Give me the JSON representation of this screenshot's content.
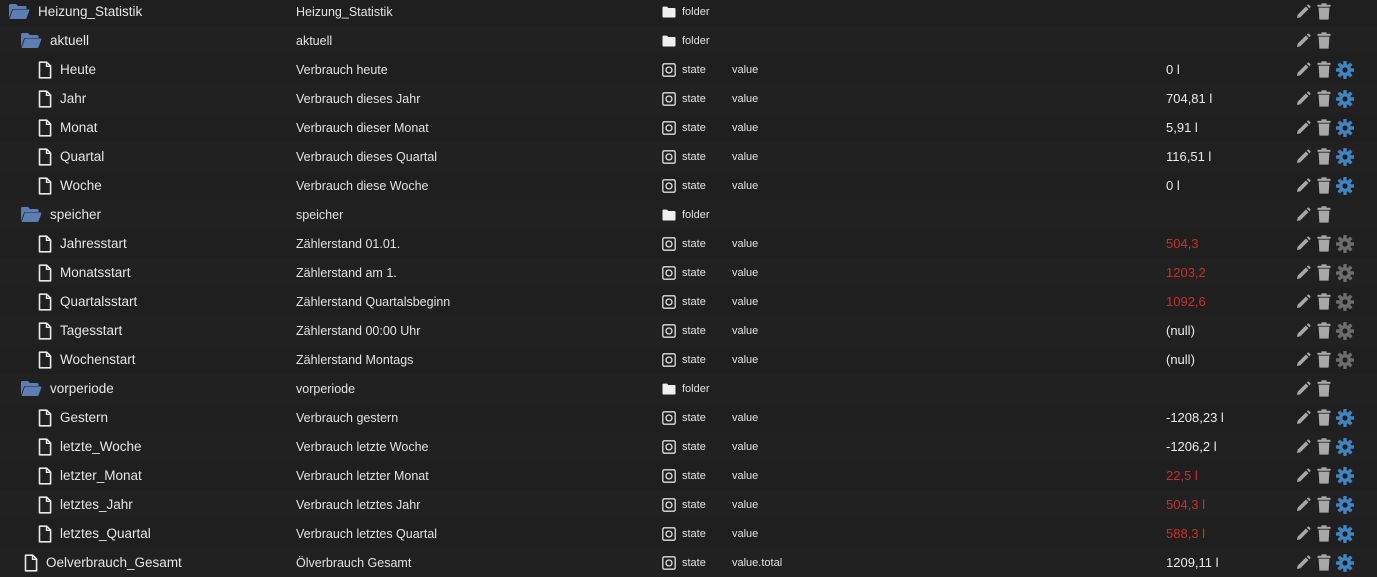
{
  "colors": {
    "background": "#1f1f1f",
    "text": "#e6e6e6",
    "folder_icon": "#5d7eb5",
    "action_icon": "#a8a8a8",
    "gear_active": "#3f85c2",
    "gear_inactive": "#6d6d6d",
    "value_red": "#c8302a"
  },
  "rows": [
    {
      "name": "Heizung_Statistik",
      "desc": "Heizung_Statistik",
      "type": "folder",
      "role": "",
      "value": "",
      "red": false,
      "kind": "folder",
      "depth": 0,
      "gear": "none"
    },
    {
      "name": "aktuell",
      "desc": "aktuell",
      "type": "folder",
      "role": "",
      "value": "",
      "red": false,
      "kind": "folder",
      "depth": 1,
      "gear": "none"
    },
    {
      "name": "Heute",
      "desc": "Verbrauch heute",
      "type": "state",
      "role": "value",
      "value": "0 l",
      "red": false,
      "kind": "file",
      "depth": 2,
      "gear": "active"
    },
    {
      "name": "Jahr",
      "desc": "Verbrauch dieses Jahr",
      "type": "state",
      "role": "value",
      "value": "704,81 l",
      "red": false,
      "kind": "file",
      "depth": 2,
      "gear": "active"
    },
    {
      "name": "Monat",
      "desc": "Verbrauch dieser Monat",
      "type": "state",
      "role": "value",
      "value": "5,91 l",
      "red": false,
      "kind": "file",
      "depth": 2,
      "gear": "active"
    },
    {
      "name": "Quartal",
      "desc": "Verbrauch dieses Quartal",
      "type": "state",
      "role": "value",
      "value": "116,51 l",
      "red": false,
      "kind": "file",
      "depth": 2,
      "gear": "active"
    },
    {
      "name": "Woche",
      "desc": "Verbrauch diese Woche",
      "type": "state",
      "role": "value",
      "value": "0 l",
      "red": false,
      "kind": "file",
      "depth": 2,
      "gear": "active"
    },
    {
      "name": "speicher",
      "desc": "speicher",
      "type": "folder",
      "role": "",
      "value": "",
      "red": false,
      "kind": "folder",
      "depth": 1,
      "gear": "none"
    },
    {
      "name": "Jahresstart",
      "desc": "Zählerstand 01.01.",
      "type": "state",
      "role": "value",
      "value": "504,3",
      "red": true,
      "kind": "file",
      "depth": 2,
      "gear": "inactive"
    },
    {
      "name": "Monatsstart",
      "desc": "Zählerstand am 1.",
      "type": "state",
      "role": "value",
      "value": "1203,2",
      "red": true,
      "kind": "file",
      "depth": 2,
      "gear": "inactive"
    },
    {
      "name": "Quartalsstart",
      "desc": "Zählerstand Quartalsbeginn",
      "type": "state",
      "role": "value",
      "value": "1092,6",
      "red": true,
      "kind": "file",
      "depth": 2,
      "gear": "inactive"
    },
    {
      "name": "Tagesstart",
      "desc": "Zählerstand 00:00 Uhr",
      "type": "state",
      "role": "value",
      "value": "(null)",
      "red": false,
      "kind": "file",
      "depth": 2,
      "gear": "inactive"
    },
    {
      "name": "Wochenstart",
      "desc": "Zählerstand Montags",
      "type": "state",
      "role": "value",
      "value": "(null)",
      "red": false,
      "kind": "file",
      "depth": 2,
      "gear": "inactive"
    },
    {
      "name": "vorperiode",
      "desc": "vorperiode",
      "type": "folder",
      "role": "",
      "value": "",
      "red": false,
      "kind": "folder",
      "depth": 1,
      "gear": "none"
    },
    {
      "name": "Gestern",
      "desc": "Verbrauch gestern",
      "type": "state",
      "role": "value",
      "value": "-1208,23 l",
      "red": false,
      "kind": "file",
      "depth": 2,
      "gear": "active"
    },
    {
      "name": "letzte_Woche",
      "desc": "Verbrauch letzte Woche",
      "type": "state",
      "role": "value",
      "value": "-1206,2 l",
      "red": false,
      "kind": "file",
      "depth": 2,
      "gear": "active"
    },
    {
      "name": "letzter_Monat",
      "desc": "Verbrauch letzter Monat",
      "type": "state",
      "role": "value",
      "value": "22,5 l",
      "red": true,
      "kind": "file",
      "depth": 2,
      "gear": "active"
    },
    {
      "name": "letztes_Jahr",
      "desc": "Verbrauch letztes Jahr",
      "type": "state",
      "role": "value",
      "value": "504,3 l",
      "red": true,
      "kind": "file",
      "depth": 2,
      "gear": "active"
    },
    {
      "name": "letztes_Quartal",
      "desc": "Verbrauch letztes Quartal",
      "type": "state",
      "role": "value",
      "value": "588,3 l",
      "red": true,
      "kind": "file",
      "depth": 2,
      "gear": "active"
    },
    {
      "name": "Oelverbrauch_Gesamt",
      "desc": "Ölverbrauch Gesamt",
      "type": "state",
      "role": "value.total",
      "value": "1209,11 l",
      "red": false,
      "kind": "file",
      "depth": 1,
      "gear": "active"
    }
  ]
}
